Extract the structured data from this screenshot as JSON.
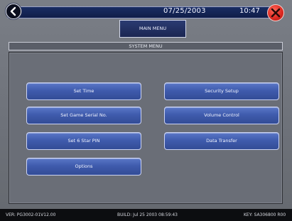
{
  "header": {
    "date": "07/25/2003",
    "time": "10:47"
  },
  "main_menu": {
    "label": "MAIN MENU"
  },
  "section": {
    "title": "SYSTEM MENU"
  },
  "buttons": {
    "set_time": "Set Time",
    "set_serial": "Set Game Serial No.",
    "set_pin": "Set 6 Star PIN",
    "options": "Options",
    "security": "Security Setup",
    "volume": "Volume Control",
    "data_transfer": "Data Transfer"
  },
  "status_bar": {
    "version": "VER: PG3002-01V12.00",
    "build": "BUILD: Jul 25 2003 08:59:43",
    "key": "KEY: SA306800 R00"
  },
  "icons": {
    "back": "back-arrow-icon",
    "close": "close-x-icon"
  },
  "colors": {
    "close_red": "#de2a22",
    "button_blue": "#3f5bad",
    "header_navy": "#1a2d63"
  }
}
